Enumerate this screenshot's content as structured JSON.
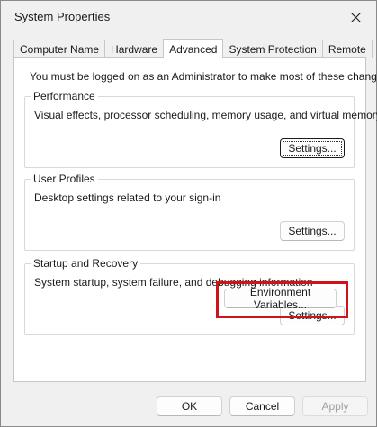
{
  "window": {
    "title": "System Properties"
  },
  "tabs": [
    {
      "label": "Computer Name",
      "active": false
    },
    {
      "label": "Hardware",
      "active": false
    },
    {
      "label": "Advanced",
      "active": true
    },
    {
      "label": "System Protection",
      "active": false
    },
    {
      "label": "Remote",
      "active": false
    }
  ],
  "advanced": {
    "intro": "You must be logged on as an Administrator to make most of these changes.",
    "performance": {
      "legend": "Performance",
      "description": "Visual effects, processor scheduling, memory usage, and virtual memory",
      "button": "Settings..."
    },
    "user_profiles": {
      "legend": "User Profiles",
      "description": "Desktop settings related to your sign-in",
      "button": "Settings..."
    },
    "startup_recovery": {
      "legend": "Startup and Recovery",
      "description": "System startup, system failure, and debugging information",
      "button": "Settings..."
    },
    "environment_button": "Environment Variables..."
  },
  "footer": {
    "ok": "OK",
    "cancel": "Cancel",
    "apply": "Apply"
  },
  "colors": {
    "highlight": "#d0121b",
    "window_bg": "#f0f0f0",
    "panel_bg": "#ffffff"
  },
  "icons": {
    "close": "close-icon"
  }
}
